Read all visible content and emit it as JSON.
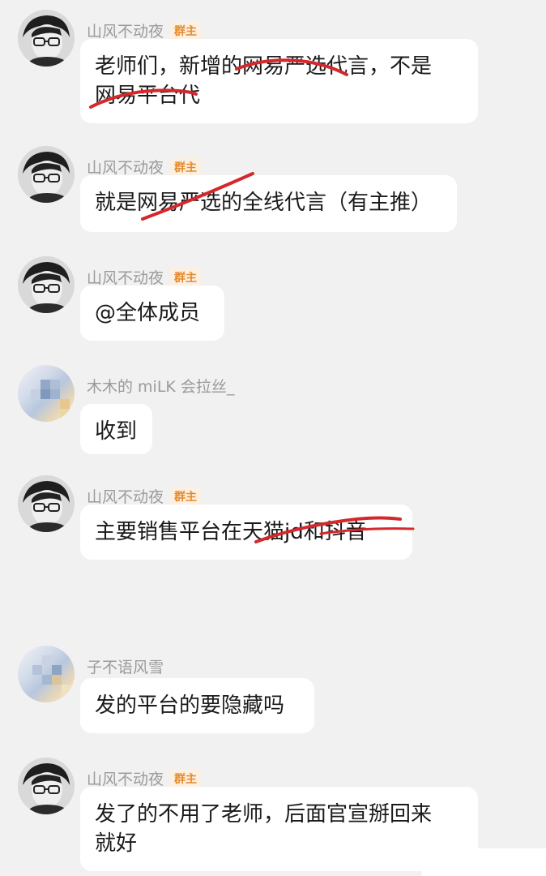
{
  "admin_badge": "群主",
  "messages": [
    {
      "sender": "山风不动夜",
      "badge": "群主",
      "lines": [
        "老师们，新增的网易严选代言，不是",
        "网易平台代"
      ]
    },
    {
      "sender": "山风不动夜",
      "badge": "群主",
      "lines": [
        "就是网易严选的全线代言（有主推）"
      ]
    },
    {
      "sender": "山风不动夜",
      "badge": "群主",
      "lines": [
        "@全体成员"
      ]
    },
    {
      "sender": "木木的 miLK 会拉丝_",
      "badge": "",
      "lines": [
        "收到"
      ]
    },
    {
      "sender": "山风不动夜",
      "badge": "群主",
      "lines": [
        "主要销售平台在天猫jd和抖音"
      ]
    },
    {
      "sender": "子不语风雪",
      "badge": "",
      "lines": [
        "发的平台的要隐藏吗"
      ]
    },
    {
      "sender": "山风不动夜",
      "badge": "群主",
      "lines": [
        "发了的不用了老师，后面官宣掰回来",
        "就好"
      ]
    }
  ],
  "colors": {
    "background": "#f1f1f1",
    "bubble": "#ffffff",
    "badge_text": "#e48a2b",
    "badge_bg": "#fcf0e3",
    "strike": "#d4282c"
  },
  "icons": {
    "owner_avatar": "avatar-portrait-icon",
    "member_avatar": "avatar-blurred-icon"
  }
}
